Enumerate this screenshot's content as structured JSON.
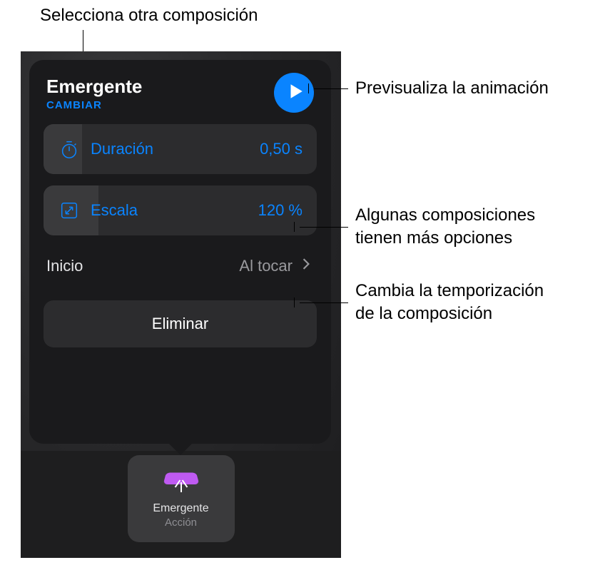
{
  "callouts": {
    "select_other": "Selecciona otra composición",
    "preview": "Previsualiza la animación",
    "more_options_l1": "Algunas composiciones",
    "more_options_l2": "tienen más opciones",
    "timing_l1": "Cambia la temporización",
    "timing_l2": "de la composición"
  },
  "panel": {
    "title": "Emergente",
    "change_label": "CAMBIAR",
    "duration": {
      "label": "Duración",
      "value": "0,50 s"
    },
    "scale": {
      "label": "Escala",
      "value": "120 %"
    },
    "start": {
      "label": "Inicio",
      "value": "Al tocar"
    },
    "delete_label": "Eliminar"
  },
  "thumbnail": {
    "title": "Emergente",
    "subtitle": "Acción"
  },
  "colors": {
    "accent": "#0a84ff",
    "purple": "#bf5af2"
  }
}
